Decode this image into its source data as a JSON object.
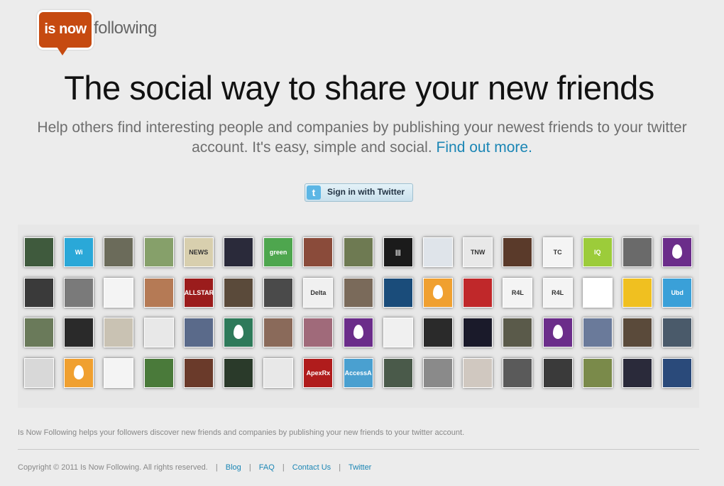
{
  "logo": {
    "bubble_text": "is now",
    "text": "following"
  },
  "headline": "The social way to share your new friends",
  "subtext": "Help others find interesting people and companies by publishing your newest friends to your twitter account. It's easy, simple and social.",
  "find_out_more": "Find out more.",
  "signin": {
    "icon": "twitter-icon",
    "label": "Sign in with Twitter"
  },
  "avatars": [
    [
      {
        "bg": "#3f5a3d",
        "text": ""
      },
      {
        "bg": "#2aa8d8",
        "text": "Wi"
      },
      {
        "bg": "#6b6b5a",
        "text": ""
      },
      {
        "bg": "#86a06a",
        "text": ""
      },
      {
        "bg": "#d8cfae",
        "text": "NEWS BREAK"
      },
      {
        "bg": "#2a2a3a",
        "text": ""
      },
      {
        "bg": "#4ea64e",
        "text": "green reviews"
      },
      {
        "bg": "#8a4b3a",
        "text": ""
      },
      {
        "bg": "#6e7a52",
        "text": ""
      },
      {
        "bg": "#1b1b1b",
        "text": "|||"
      },
      {
        "bg": "#dfe4ea",
        "text": ""
      },
      {
        "bg": "#e8e8e8",
        "text": "TNW ALL STORIES"
      },
      {
        "bg": "#5a3a2a",
        "text": ""
      },
      {
        "bg": "#f4f4f4",
        "text": "TC"
      },
      {
        "bg": "#9ccc3a",
        "text": "IQ"
      },
      {
        "bg": "#6a6a6a",
        "text": ""
      },
      {
        "bg": "#6b2d8a",
        "text": "",
        "egg": true
      }
    ],
    [
      {
        "bg": "#3a3a3a",
        "text": ""
      },
      {
        "bg": "#7a7a7a",
        "text": ""
      },
      {
        "bg": "#f4f4f4",
        "text": ""
      },
      {
        "bg": "#b57a55",
        "text": ""
      },
      {
        "bg": "#9b1c1c",
        "text": "ALLSTAR"
      },
      {
        "bg": "#5a4a3a",
        "text": ""
      },
      {
        "bg": "#4a4a4a",
        "text": ""
      },
      {
        "bg": "#f0f0f0",
        "text": "Delta Index"
      },
      {
        "bg": "#7a6a5a",
        "text": ""
      },
      {
        "bg": "#1a4c7a",
        "text": ""
      },
      {
        "bg": "#f0a030",
        "text": "",
        "egg": true
      },
      {
        "bg": "#c0282a",
        "text": ""
      },
      {
        "bg": "#f4f4f4",
        "text": "R4L"
      },
      {
        "bg": "#f4f4f4",
        "text": "R4L"
      },
      {
        "bg": "#ffffff",
        "text": ""
      },
      {
        "bg": "#f0c020",
        "text": ""
      },
      {
        "bg": "#3aa0d8",
        "text": "Ubd"
      }
    ],
    [
      {
        "bg": "#6a7a5a",
        "text": ""
      },
      {
        "bg": "#2a2a2a",
        "text": ""
      },
      {
        "bg": "#c9c2b3",
        "text": ""
      },
      {
        "bg": "#e8e8e8",
        "text": ""
      },
      {
        "bg": "#5a6a8a",
        "text": ""
      },
      {
        "bg": "#2e7a5a",
        "text": "",
        "egg": true
      },
      {
        "bg": "#8a6a5a",
        "text": ""
      },
      {
        "bg": "#a06a7a",
        "text": ""
      },
      {
        "bg": "#6b2d8a",
        "text": "",
        "egg": true
      },
      {
        "bg": "#f0f0f0",
        "text": ""
      },
      {
        "bg": "#2a2a2a",
        "text": ""
      },
      {
        "bg": "#1a1a2a",
        "text": ""
      },
      {
        "bg": "#5a5a4a",
        "text": ""
      },
      {
        "bg": "#6b2d8a",
        "text": "",
        "egg": true
      },
      {
        "bg": "#6a7a9a",
        "text": ""
      },
      {
        "bg": "#5a4a3a",
        "text": ""
      },
      {
        "bg": "#4a5a6a",
        "text": ""
      }
    ],
    [
      {
        "bg": "#d8d8d8",
        "text": ""
      },
      {
        "bg": "#f0a030",
        "text": "",
        "egg": true
      },
      {
        "bg": "#f4f4f4",
        "text": ""
      },
      {
        "bg": "#4a7a3a",
        "text": ""
      },
      {
        "bg": "#6a3a2a",
        "text": ""
      },
      {
        "bg": "#2a3a2a",
        "text": ""
      },
      {
        "bg": "#e8e8e8",
        "text": ""
      },
      {
        "bg": "#b01c1c",
        "text": "ApexRx"
      },
      {
        "bg": "#4aa0d0",
        "text": "AccessA"
      },
      {
        "bg": "#4a5a4a",
        "text": ""
      },
      {
        "bg": "#8a8a8a",
        "text": ""
      },
      {
        "bg": "#d0c8c0",
        "text": ""
      },
      {
        "bg": "#5a5a5a",
        "text": ""
      },
      {
        "bg": "#3a3a3a",
        "text": ""
      },
      {
        "bg": "#7a8a4a",
        "text": ""
      },
      {
        "bg": "#2a2a3a",
        "text": ""
      },
      {
        "bg": "#2a4a7a",
        "text": ""
      }
    ]
  ],
  "footer": {
    "description": "Is Now Following helps your followers discover new friends and companies by publishing your new friends to your twitter account.",
    "copyright": "Copyright © 2011 Is Now Following. All rights reserved.",
    "links": [
      "Blog",
      "FAQ",
      "Contact Us",
      "Twitter"
    ]
  }
}
